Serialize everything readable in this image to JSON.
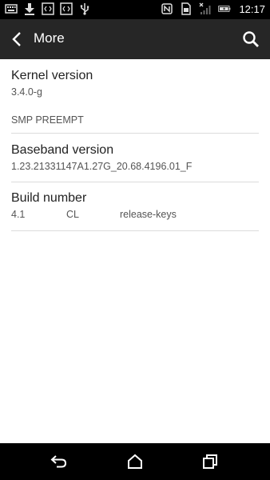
{
  "status_bar": {
    "left_icons": [
      "keyboard-icon",
      "download-icon",
      "code-icon",
      "code-icon",
      "usb-icon"
    ],
    "right_icons": [
      "nfc-icon",
      "sim-icon",
      "signal-icon",
      "battery-icon"
    ],
    "time": "12:17"
  },
  "action_bar": {
    "title": "More",
    "back_icon": "chevron-left-icon",
    "search_icon": "search-icon"
  },
  "items": {
    "kernel": {
      "title": "Kernel version",
      "line1": "3.4.0-g",
      "line2": "SMP PREEMPT"
    },
    "baseband": {
      "title": "Baseband version",
      "value": "1.23.21331147A1.27G_20.68.4196.01_F"
    },
    "build": {
      "title": "Build number",
      "parts": [
        "4.1",
        "CL",
        "release-keys"
      ]
    }
  },
  "nav_bar": {
    "icons": [
      "back-icon",
      "home-icon",
      "recents-icon"
    ]
  },
  "colors": {
    "status_bar": "#000000",
    "action_bar": "#262626",
    "background": "#ffffff",
    "divider": "#dcdcdc"
  }
}
